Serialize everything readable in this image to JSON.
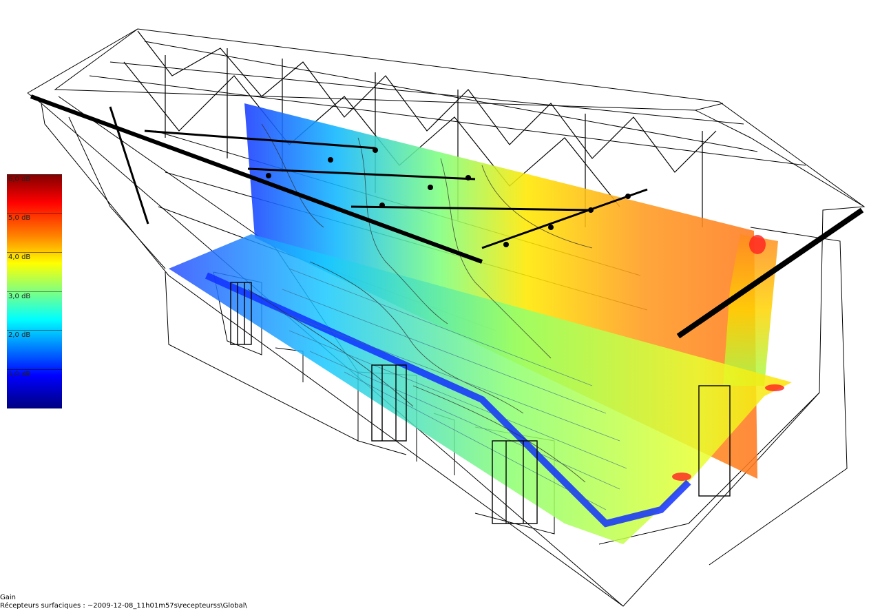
{
  "legend": {
    "ticks": [
      "6,0 dB",
      "5,0 dB",
      "4,0 dB",
      "3,0 dB",
      "2,0 dB",
      "1,0 dB"
    ]
  },
  "caption": {
    "line1": "Gain",
    "line2": "Récepteurs surfaciques : ~2009-12-08_11h01m57s\\recepteurss\\Global\\"
  },
  "colors": {
    "low": "#000080",
    "mid": "#ffff00",
    "high": "#800000"
  }
}
